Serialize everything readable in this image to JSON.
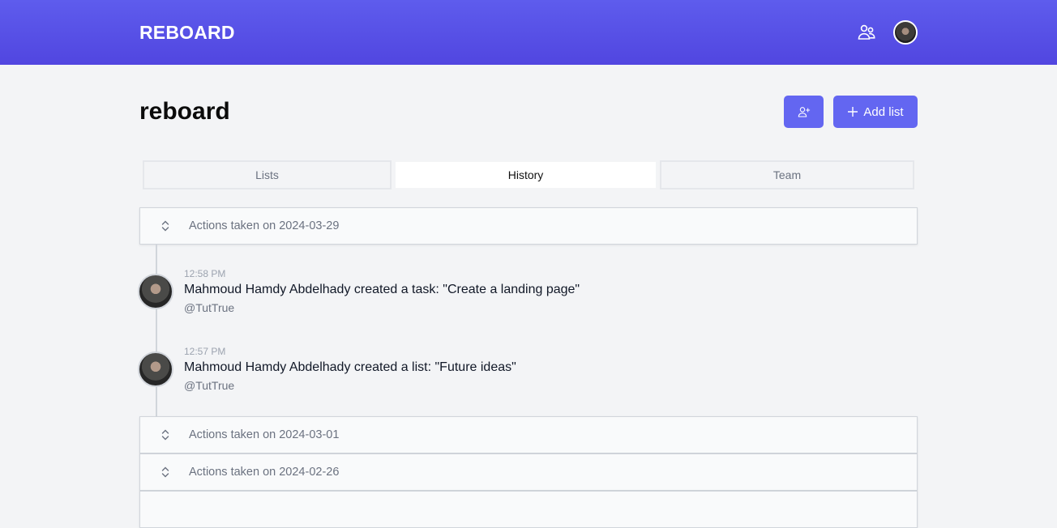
{
  "header": {
    "brand": "REBOARD",
    "icons": [
      "team-icon",
      "user-avatar"
    ],
    "colors": {
      "primary": "#5a57ea",
      "button": "#6366f1"
    }
  },
  "page": {
    "title": "reboard",
    "invite_button_icon": "user-plus-icon",
    "add_list_label": "Add list",
    "add_list_icon": "plus-icon"
  },
  "tabs": [
    {
      "label": "Lists",
      "active": false
    },
    {
      "label": "History",
      "active": true
    },
    {
      "label": "Team",
      "active": false
    }
  ],
  "history": {
    "groups": [
      {
        "label": "Actions taken on 2024-03-29",
        "expanded": true,
        "entries": [
          {
            "time": "12:58 PM",
            "text": "Mahmoud Hamdy Abdelhady created a task: \"Create a landing page\"",
            "user": "@TutTrue"
          },
          {
            "time": "12:57 PM",
            "text": "Mahmoud Hamdy Abdelhady created a list: \"Future ideas\"",
            "user": "@TutTrue"
          }
        ]
      },
      {
        "label": "Actions taken on 2024-03-01",
        "expanded": false
      },
      {
        "label": "Actions taken on 2024-02-26",
        "expanded": false
      }
    ]
  }
}
